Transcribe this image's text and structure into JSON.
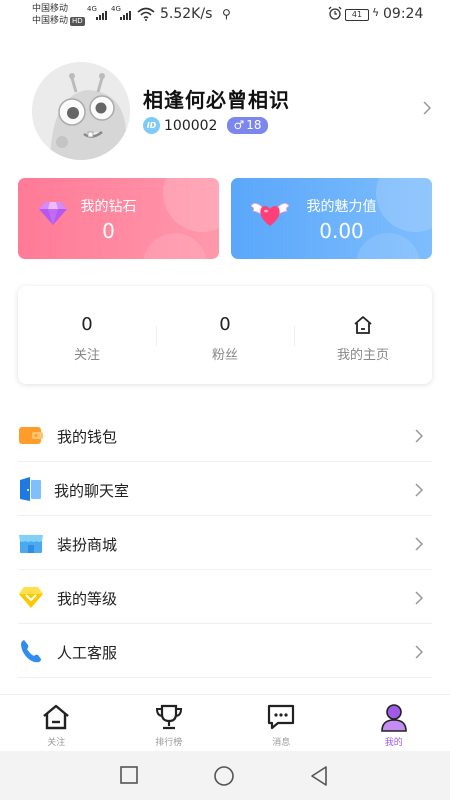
{
  "status_bar": {
    "carrier1": "中国移动",
    "carrier2": "中国移动",
    "hd": "HD",
    "net1": "4G",
    "net2": "4G",
    "speed": "5.52K/s",
    "battery": "41",
    "time": "09:24"
  },
  "profile": {
    "nickname": "相逢何必曾相识",
    "id_badge": "ID",
    "id": "100002",
    "gender_symbol": "♂",
    "age": "18"
  },
  "cards": {
    "diamond": {
      "title": "我的钻石",
      "value": "0"
    },
    "charm": {
      "title": "我的魅力值",
      "value": "0.00"
    }
  },
  "stats": {
    "following": {
      "count": "0",
      "label": "关注"
    },
    "fans": {
      "count": "0",
      "label": "粉丝"
    },
    "homepage": {
      "label": "我的主页"
    }
  },
  "menu": {
    "items": [
      {
        "label": "我的钱包",
        "icon": "wallet-icon"
      },
      {
        "label": "我的聊天室",
        "icon": "chatroom-icon"
      },
      {
        "label": "装扮商城",
        "icon": "store-icon"
      },
      {
        "label": "我的等级",
        "icon": "level-gem-icon"
      },
      {
        "label": "人工客服",
        "icon": "phone-icon"
      }
    ]
  },
  "tabbar": {
    "tabs": [
      {
        "label": "关注",
        "icon": "home-icon"
      },
      {
        "label": "排行榜",
        "icon": "trophy-icon"
      },
      {
        "label": "消息",
        "icon": "message-icon"
      },
      {
        "label": "我的",
        "icon": "user-icon"
      }
    ],
    "active_index": 3
  },
  "colors": {
    "diamond_card": "#ff7a96",
    "charm_card": "#5aa7fb",
    "accent": "#a05ae6",
    "gender_badge": "#7b86ee"
  }
}
